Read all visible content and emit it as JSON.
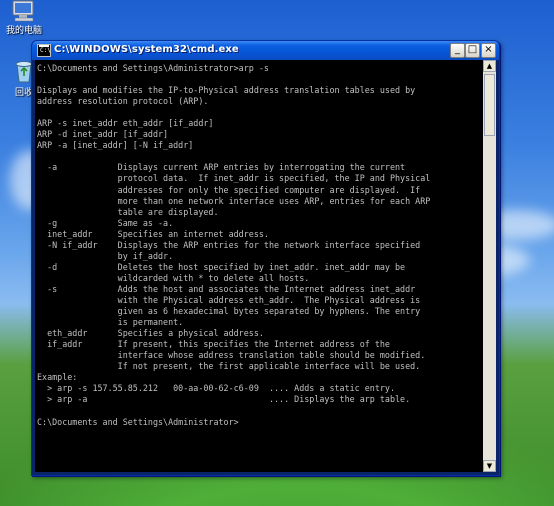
{
  "desktop": {
    "icons": [
      {
        "name": "my-computer-icon",
        "label": "我的电脑"
      },
      {
        "name": "recycle-bin-icon",
        "label": "回收"
      }
    ]
  },
  "window": {
    "title": "C:\\WINDOWS\\system32\\cmd.exe",
    "buttons": {
      "minimize": "_",
      "maximize": "□",
      "close": "×"
    }
  },
  "console": {
    "lines": [
      "C:\\Documents and Settings\\Administrator>arp -s",
      "",
      "Displays and modifies the IP-to-Physical address translation tables used by",
      "address resolution protocol (ARP).",
      "",
      "ARP -s inet_addr eth_addr [if_addr]",
      "ARP -d inet_addr [if_addr]",
      "ARP -a [inet_addr] [-N if_addr]",
      "",
      "  -a            Displays current ARP entries by interrogating the current",
      "                protocol data.  If inet_addr is specified, the IP and Physical",
      "                addresses for only the specified computer are displayed.  If",
      "                more than one network interface uses ARP, entries for each ARP",
      "                table are displayed.",
      "  -g            Same as -a.",
      "  inet_addr     Specifies an internet address.",
      "  -N if_addr    Displays the ARP entries for the network interface specified",
      "                by if_addr.",
      "  -d            Deletes the host specified by inet_addr. inet_addr may be",
      "                wildcarded with * to delete all hosts.",
      "  -s            Adds the host and associates the Internet address inet_addr",
      "                with the Physical address eth_addr.  The Physical address is",
      "                given as 6 hexadecimal bytes separated by hyphens. The entry",
      "                is permanent.",
      "  eth_addr      Specifies a physical address.",
      "  if_addr       If present, this specifies the Internet address of the",
      "                interface whose address translation table should be modified.",
      "                If not present, the first applicable interface will be used.",
      "Example:",
      "  > arp -s 157.55.85.212   00-aa-00-62-c6-09  .... Adds a static entry.",
      "  > arp -a                                    .... Displays the arp table.",
      "",
      "C:\\Documents and Settings\\Administrator>"
    ]
  },
  "scrollbar": {
    "up_arrow": "▲",
    "down_arrow": "▼",
    "position": 0.0
  }
}
